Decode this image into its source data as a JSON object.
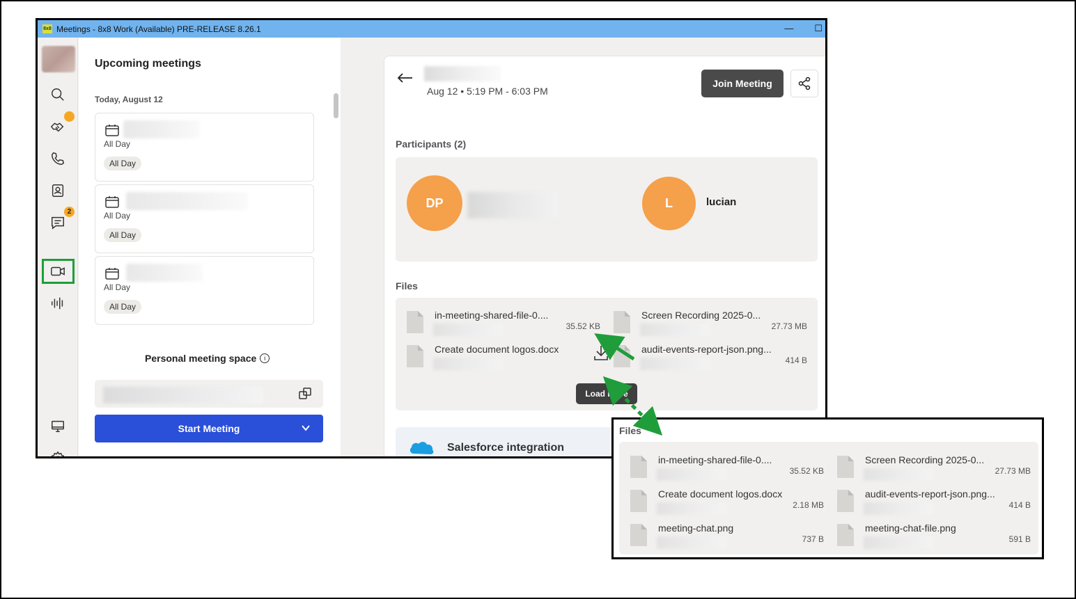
{
  "window": {
    "title": "Meetings - 8x8 Work (Available) PRE-RELEASE 8.26.1",
    "logo_text": "8x8",
    "minimize": "—",
    "maximize": "☐"
  },
  "rail": {
    "badges": {
      "chat": "2"
    }
  },
  "list": {
    "heading": "Upcoming meetings",
    "date": "Today, August 12",
    "meetings": [
      {
        "time": "All Day",
        "pill": "All Day"
      },
      {
        "time": "All Day",
        "pill": "All Day"
      },
      {
        "time": "All Day",
        "pill": "All Day"
      }
    ],
    "personal_space_label": "Personal meeting space",
    "info_glyph": "i",
    "start_button": "Start Meeting"
  },
  "detail": {
    "time": "Aug 12 • 5:19 PM - 6:03 PM",
    "join_button": "Join Meeting",
    "participants_label": "Participants (2)",
    "participants": [
      {
        "initials": "DP",
        "name": ""
      },
      {
        "initials": "L",
        "name": "lucian"
      }
    ],
    "files_label": "Files",
    "files": [
      {
        "name": "in-meeting-shared-file-0....",
        "size": "35.52 KB"
      },
      {
        "name": "Screen Recording 2025-0...",
        "size": "27.73 MB"
      },
      {
        "name": "Create document logos.docx",
        "size": ""
      },
      {
        "name": "audit-events-report-json.png...",
        "size": "414 B"
      }
    ],
    "load_more": "Load more",
    "salesforce_label": "Salesforce integration"
  },
  "zoom": {
    "files_label": "Files",
    "files": [
      {
        "name": "in-meeting-shared-file-0....",
        "size": "35.52 KB"
      },
      {
        "name": "Screen Recording 2025-0...",
        "size": "27.73 MB"
      },
      {
        "name": "Create document logos.docx",
        "size": "2.18 MB"
      },
      {
        "name": "audit-events-report-json.png...",
        "size": "414 B"
      },
      {
        "name": "meeting-chat.png",
        "size": "737 B"
      },
      {
        "name": "meeting-chat-file.png",
        "size": "591 B"
      }
    ]
  },
  "colors": {
    "title_bar": "#70b3ee",
    "start_button": "#2a4fd8",
    "avatar": "#f5a04a",
    "badge": "#f5a623",
    "annotation_green": "#1f9d3a"
  }
}
